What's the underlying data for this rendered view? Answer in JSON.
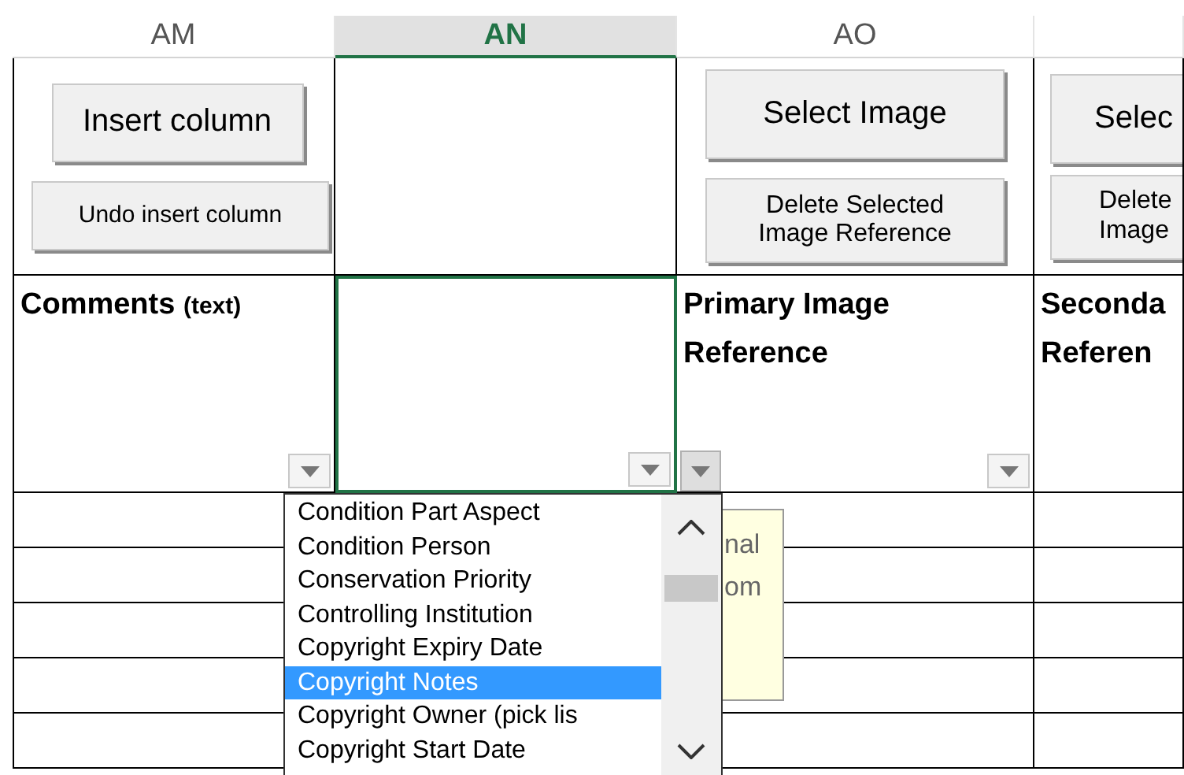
{
  "columns": [
    {
      "header": "AM",
      "selected": false,
      "buttons": [
        {
          "kind": "large",
          "lines": [
            "Insert column"
          ]
        },
        {
          "kind": "small",
          "lines": [
            "Undo insert column"
          ]
        }
      ],
      "title": [
        "Comments"
      ],
      "title_note": "(text)",
      "filter": true
    },
    {
      "header": "AN",
      "selected": true,
      "filter": true
    },
    {
      "header": "AO",
      "selected": false,
      "buttons": [
        {
          "kind": "large",
          "lines": [
            "Select Image"
          ]
        },
        {
          "kind": "small",
          "lines": [
            "Delete Selected",
            "Image Reference"
          ]
        }
      ],
      "title": [
        "Primary Image",
        "Reference"
      ],
      "filter": true
    },
    {
      "selected": false,
      "buttons": [
        {
          "kind": "large",
          "lines": [
            "Selec"
          ]
        },
        {
          "kind": "small",
          "lines": [
            "Delete",
            "Image"
          ]
        }
      ],
      "title": [
        "Seconda",
        "Referen"
      ]
    }
  ],
  "dropdown": {
    "items": [
      {
        "label": "Condition Part Aspect",
        "selected": false
      },
      {
        "label": "Condition Person",
        "selected": false
      },
      {
        "label": "Conservation Priority",
        "selected": false
      },
      {
        "label": "Controlling Institution",
        "selected": false
      },
      {
        "label": "Copyright Expiry Date",
        "selected": false
      },
      {
        "label": "Copyright Notes",
        "selected": true
      },
      {
        "label": "Copyright Owner  (pick lis",
        "selected": false
      },
      {
        "label": "Copyright Start Date",
        "selected": false
      }
    ]
  },
  "note": {
    "lines": [
      "nal",
      "om"
    ]
  }
}
